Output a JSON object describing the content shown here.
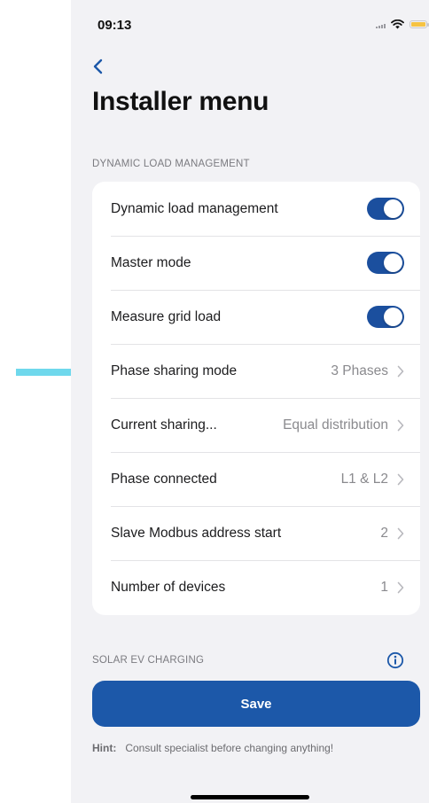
{
  "status_bar": {
    "time": "09:13",
    "icons": [
      "signal-icon",
      "wifi-icon",
      "battery-icon"
    ]
  },
  "nav": {
    "back_icon": "chevron-left-icon",
    "title": "Installer menu"
  },
  "sections": {
    "dynamic_load": {
      "header": "DYNAMIC LOAD MANAGEMENT",
      "rows": [
        {
          "label": "Dynamic load management",
          "type": "toggle",
          "on": true
        },
        {
          "label": "Master mode",
          "type": "toggle",
          "on": true
        },
        {
          "label": "Measure grid load",
          "type": "toggle",
          "on": true
        },
        {
          "label": "Phase sharing mode",
          "type": "disclosure",
          "value": "3 Phases"
        },
        {
          "label": "Current sharing...",
          "type": "disclosure",
          "value": "Equal distribution"
        },
        {
          "label": "Phase connected",
          "type": "disclosure",
          "value": "L1 & L2"
        },
        {
          "label": "Slave Modbus address start",
          "type": "disclosure",
          "value": "2"
        },
        {
          "label": "Number of devices",
          "type": "disclosure",
          "value": "1"
        }
      ]
    },
    "solar": {
      "header": "SOLAR EV CHARGING",
      "icon": "info-icon"
    }
  },
  "actions": {
    "save_label": "Save"
  },
  "hint": {
    "label": "Hint:",
    "text": "Consult specialist before changing anything!"
  },
  "colors": {
    "accent": "#1c58a9",
    "toggle_on": "#1b4f9e",
    "background": "#f2f2f5",
    "annotation_arrow": "#6fd8ec"
  }
}
